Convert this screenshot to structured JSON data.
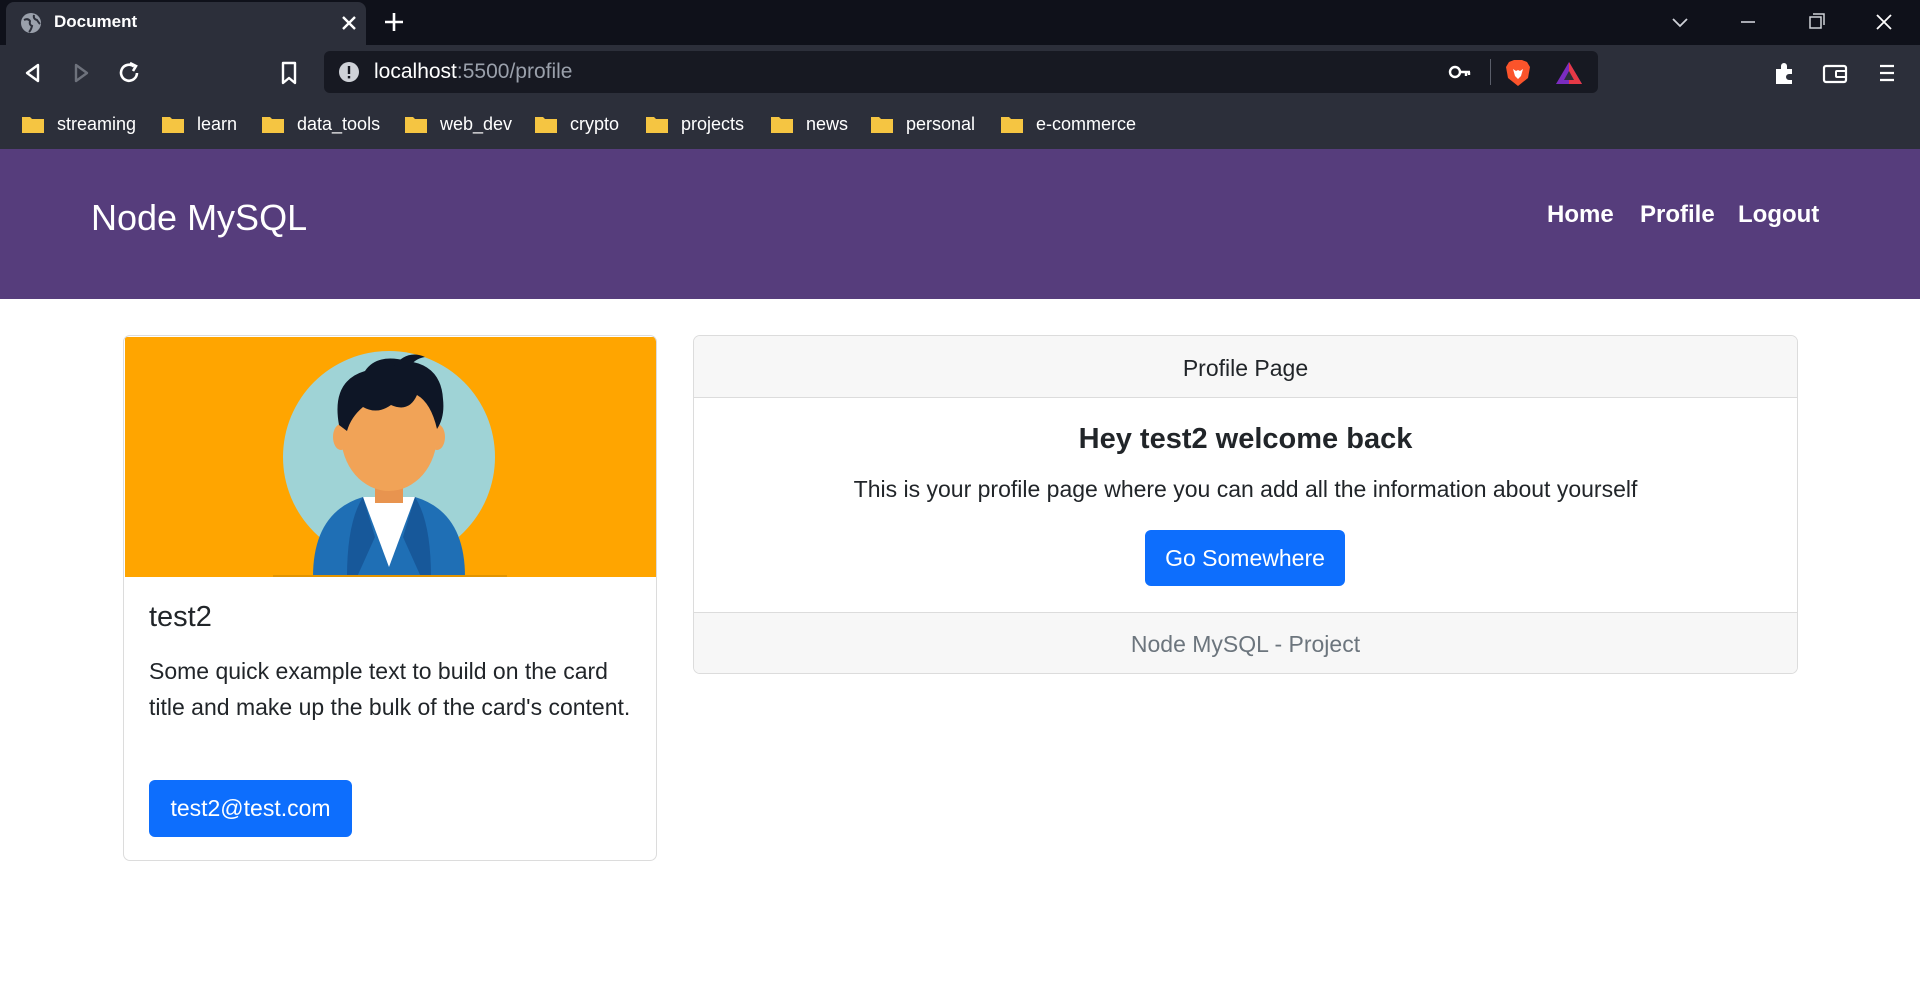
{
  "browser": {
    "tab_title": "Document",
    "url_host": "localhost",
    "url_path": ":5500/profile",
    "bookmarks": [
      "streaming",
      "learn",
      "data_tools",
      "web_dev",
      "crypto",
      "projects",
      "news",
      "personal",
      "e-commerce"
    ]
  },
  "navbar": {
    "brand": "Node MySQL",
    "links": [
      "Home",
      "Profile",
      "Logout"
    ]
  },
  "profile_card": {
    "title": "test2",
    "text": "Some quick example text to build on the card title and make up the bulk of the card's content.",
    "email_button": "test2@test.com"
  },
  "main_card": {
    "header": "Profile Page",
    "welcome": "Hey test2 welcome back",
    "description": "This is your profile page where you can add all the information about yourself",
    "button": "Go Somewhere",
    "footer": "Node MySQL - Project"
  },
  "colors": {
    "navbar_bg": "#563d7c",
    "primary": "#0d6efd",
    "avatar_bg": "#ffa500"
  }
}
